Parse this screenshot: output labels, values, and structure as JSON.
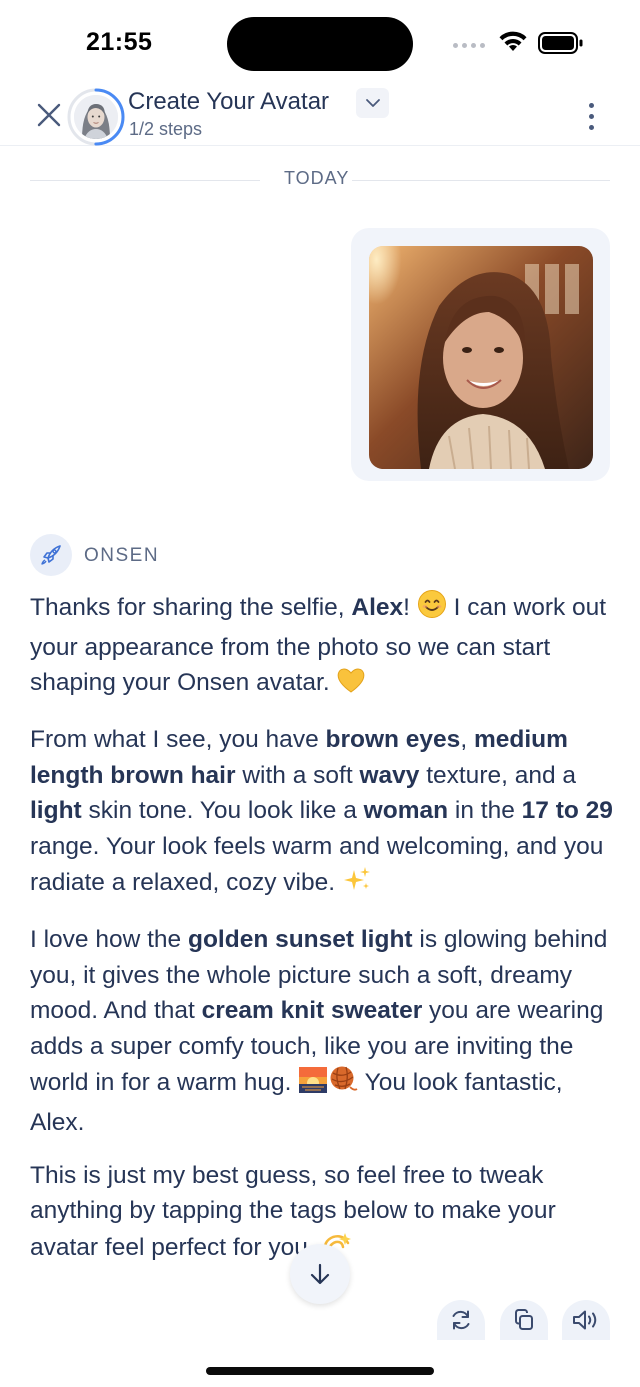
{
  "status_bar": {
    "time": "21:55"
  },
  "header": {
    "title": "Create Your Avatar",
    "steps": "1/2 steps",
    "progress": 0.5
  },
  "divider": {
    "label": "TODAY"
  },
  "bot": {
    "name": "ONSEN"
  },
  "message": {
    "p1": {
      "a": "Thanks for sharing the selfie, ",
      "b_name": "Alex",
      "c": "! ",
      "d": " I can work out your appearance from the photo so we can start shaping your Onsen avatar. "
    },
    "p2": {
      "a": "From what I see, you have ",
      "b1": "brown eyes",
      "c": ", ",
      "b2": "medium length brown hair",
      "d": " with a soft ",
      "b3": "wavy",
      "e": " texture, and a ",
      "b4": "light",
      "f": " skin tone. You look like a ",
      "b5": "woman",
      "g": " in the ",
      "b6": "17 to 29",
      "h": " range. Your look feels warm and welcoming, and you radiate a relaxed, cozy vibe. "
    },
    "p3": {
      "a": "I love how the ",
      "b1": "golden sunset light",
      "c": " is glowing behind you, it gives the whole picture such a soft, dreamy mood. And that ",
      "b2": "cream knit sweater",
      "d": " you are wearing adds a super comfy touch, like you are inviting the world in for a warm hug. ",
      "e": " You look fantastic, Alex."
    },
    "p4": {
      "a": "This is just my best guess, so feel free to tweak anything by tapping the tags below to make your avatar feel perfect for you. "
    }
  },
  "icons": {
    "close": "close-icon",
    "chevron": "chevron-down-icon",
    "more": "more-vertical-icon",
    "bot": "rocket-icon",
    "scroll": "arrow-down-icon",
    "regenerate": "refresh-icon",
    "copy": "copy-icon",
    "speaker": "speaker-icon"
  },
  "colors": {
    "accent": "#4a8af4",
    "text": "#263556",
    "muted": "#5d6b86",
    "bubble": "#f1f4fa"
  }
}
